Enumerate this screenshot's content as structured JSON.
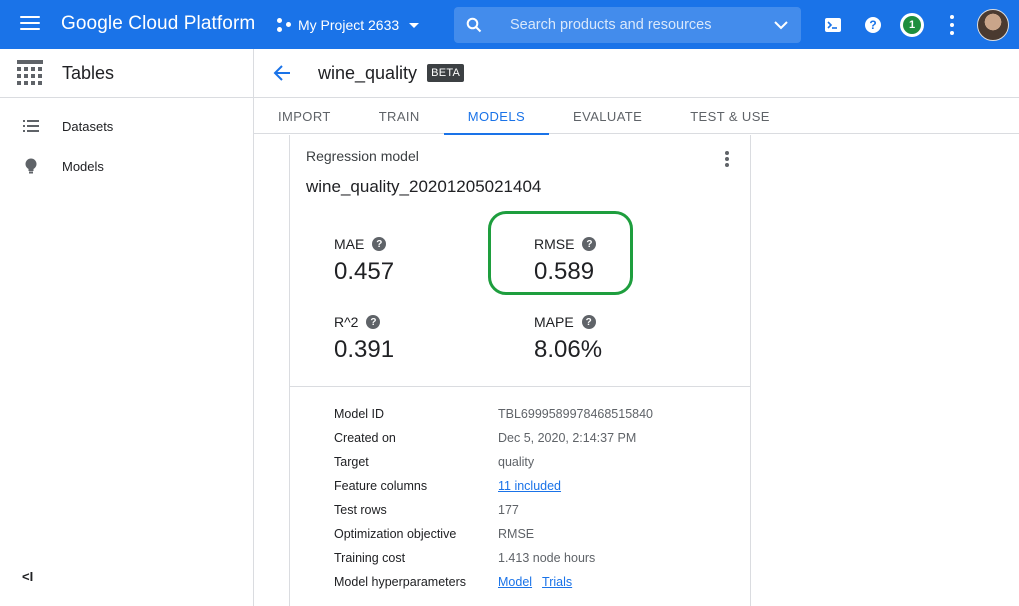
{
  "header": {
    "brand": "Google Cloud Platform",
    "project": "My Project 2633",
    "search_placeholder": "Search products and resources",
    "notification_count": "1",
    "help_glyph": "?"
  },
  "sidebar": {
    "title": "Tables",
    "items": [
      {
        "label": "Datasets",
        "icon": "list-icon"
      },
      {
        "label": "Models",
        "icon": "lightbulb-icon"
      }
    ],
    "collapse_glyph": "<I"
  },
  "page": {
    "title": "wine_quality",
    "badge": "BETA"
  },
  "tabs": [
    {
      "label": "IMPORT",
      "active": false
    },
    {
      "label": "TRAIN",
      "active": false
    },
    {
      "label": "MODELS",
      "active": true
    },
    {
      "label": "EVALUATE",
      "active": false
    },
    {
      "label": "TEST & USE",
      "active": false
    }
  ],
  "card": {
    "type": "Regression model",
    "name": "wine_quality_20201205021404",
    "metrics": [
      {
        "label": "MAE",
        "value": "0.457"
      },
      {
        "label": "RMSE",
        "value": "0.589",
        "highlighted": true
      },
      {
        "label": "R^2",
        "value": "0.391"
      },
      {
        "label": "MAPE",
        "value": "8.06%"
      }
    ],
    "details": {
      "model_id_label": "Model ID",
      "model_id": "TBL6999589978468515840",
      "created_label": "Created on",
      "created": "Dec 5, 2020, 2:14:37 PM",
      "target_label": "Target",
      "target": "quality",
      "features_label": "Feature columns",
      "features": "11 included",
      "test_rows_label": "Test rows",
      "test_rows": "177",
      "objective_label": "Optimization objective",
      "objective": "RMSE",
      "cost_label": "Training cost",
      "cost": "1.413 node hours",
      "hyper_label": "Model hyperparameters",
      "hyper_link1": "Model",
      "hyper_link2": "Trials"
    }
  },
  "colors": {
    "primary": "#1a73e8",
    "highlight": "#1e9e3e"
  }
}
